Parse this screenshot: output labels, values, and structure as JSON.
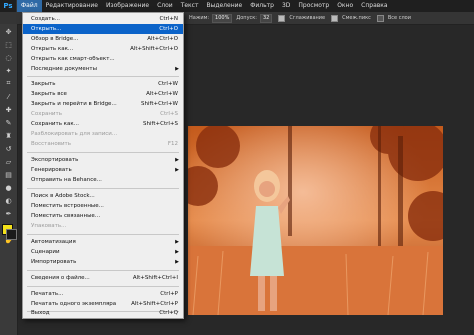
{
  "app": {
    "logo": "Ps"
  },
  "menubar": [
    "Файл",
    "Редактирование",
    "Изображение",
    "Слои",
    "Текст",
    "Выделение",
    "Фильтр",
    "3D",
    "Просмотр",
    "Окно",
    "Справка"
  ],
  "options": {
    "opacity_label": "Нажим:",
    "opacity_value": "100%",
    "tolerance_label": "Допуск:",
    "tolerance_value": "32",
    "antialias_label": "Сглаживание",
    "contiguous_label": "Смеж.пикс",
    "all_layers_label": "Все слои"
  },
  "file_menu": {
    "items": [
      {
        "label": "Создать...",
        "shortcut": "Ctrl+N"
      },
      {
        "label": "Открыть...",
        "shortcut": "Ctrl+O"
      },
      {
        "label": "Обзор в Bridge...",
        "shortcut": "Alt+Ctrl+O"
      },
      {
        "label": "Открыть как...",
        "shortcut": "Alt+Shift+Ctrl+O"
      },
      {
        "label": "Открыть как смарт-объект...",
        "shortcut": ""
      },
      {
        "label": "Последние документы",
        "shortcut": ""
      },
      {
        "label": "Закрыть",
        "shortcut": "Ctrl+W"
      },
      {
        "label": "Закрыть все",
        "shortcut": "Alt+Ctrl+W"
      },
      {
        "label": "Закрыть и перейти в Bridge...",
        "shortcut": "Shift+Ctrl+W"
      },
      {
        "label": "Сохранить",
        "shortcut": "Ctrl+S"
      },
      {
        "label": "Сохранить как...",
        "shortcut": "Shift+Ctrl+S"
      },
      {
        "label": "Разблокировать для записи...",
        "shortcut": ""
      },
      {
        "label": "Восстановить",
        "shortcut": "F12"
      },
      {
        "label": "Экспортировать",
        "shortcut": ""
      },
      {
        "label": "Генерировать",
        "shortcut": ""
      },
      {
        "label": "Отправить на Behance...",
        "shortcut": ""
      },
      {
        "label": "Поиск в Adobe Stock...",
        "shortcut": ""
      },
      {
        "label": "Поместить встроенные...",
        "shortcut": ""
      },
      {
        "label": "Поместить связанные...",
        "shortcut": ""
      },
      {
        "label": "Упаковать...",
        "shortcut": ""
      },
      {
        "label": "Автоматизация",
        "shortcut": ""
      },
      {
        "label": "Сценарии",
        "shortcut": ""
      },
      {
        "label": "Импортировать",
        "shortcut": ""
      },
      {
        "label": "Сведения о файле...",
        "shortcut": "Alt+Shift+Ctrl+I"
      },
      {
        "label": "Печатать...",
        "shortcut": "Ctrl+P"
      },
      {
        "label": "Печатать одного экземпляра",
        "shortcut": "Alt+Shift+Ctrl+P"
      },
      {
        "label": "Выход",
        "shortcut": "Ctrl+Q"
      }
    ]
  },
  "colors": {
    "foreground": "#f3e11a",
    "background": "#1a1a1a",
    "highlight": "#0b63c9"
  }
}
